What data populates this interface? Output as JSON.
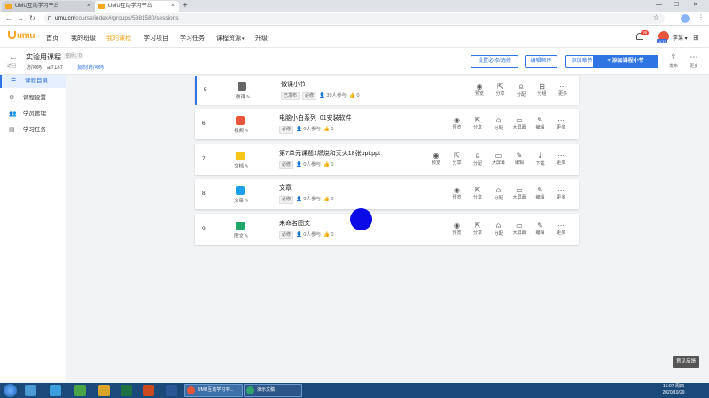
{
  "browser": {
    "tabs": [
      {
        "label": "UMU互动学习平台"
      },
      {
        "label": "UMU互动学习平台"
      }
    ],
    "url_host": "umu.cn",
    "url_path": "/course/index#/groups/5381580/sessions"
  },
  "topnav": {
    "logo": "umu",
    "items": [
      "首页",
      "我的班级",
      "我的课程",
      "学习项目",
      "学习任务",
      "课程资源",
      "升级"
    ],
    "active": "我的课程",
    "notification_count": "99",
    "avatar_level": "LV.15",
    "username": "李某"
  },
  "course": {
    "back_label": "返回",
    "title": "实验用课程",
    "tag": "空间：0",
    "access_code_label": "访问码：",
    "access_code": "ai7187",
    "copy_link": "复制访问码",
    "buttons": {
      "required": "设置必修/选修",
      "order": "编辑顺序",
      "chapter": "添加章节",
      "add_section": "添加课程小节"
    },
    "tools": {
      "publish": "发布",
      "more": "更多"
    }
  },
  "sidebar": {
    "items": [
      {
        "label": "课程目录",
        "icon": "list-icon"
      },
      {
        "label": "课程设置",
        "icon": "gear-icon"
      },
      {
        "label": "学员管理",
        "icon": "users-icon"
      },
      {
        "label": "学习任务",
        "icon": "clipboard-icon"
      }
    ]
  },
  "sessions": [
    {
      "num": "5",
      "type": "微课",
      "title": "微课小节",
      "status": "已发布",
      "req": "必修",
      "participants": "39人参与",
      "likes": "0",
      "color": "#666666",
      "actions": [
        "预览",
        "分享",
        "分配",
        "分组",
        "更多"
      ]
    },
    {
      "num": "6",
      "type": "视频",
      "title": "电脑小白系列_01安装软件",
      "req": "必修",
      "participants": "0人参与",
      "likes": "0",
      "color": "#e8553b",
      "actions": [
        "预览",
        "分享",
        "分配",
        "大屏幕",
        "编辑",
        "更多"
      ]
    },
    {
      "num": "7",
      "type": "文档",
      "title": "第7单元课题1燃烧和灭火18张ppt.ppt",
      "req": "必修",
      "participants": "0人参与",
      "likes": "0",
      "color": "#f5c518",
      "actions": [
        "预览",
        "分享",
        "分配",
        "大屏幕",
        "编辑",
        "下载",
        "更多"
      ]
    },
    {
      "num": "8",
      "type": "文章",
      "title": "文章",
      "req": "必修",
      "participants": "0人参与",
      "likes": "0",
      "color": "#1aa0e8",
      "actions": [
        "预览",
        "分享",
        "分配",
        "大屏幕",
        "编辑",
        "更多"
      ]
    },
    {
      "num": "9",
      "type": "图文",
      "title": "未命名图文",
      "req": "必修",
      "participants": "0人参与",
      "likes": "0",
      "color": "#1fa86a",
      "actions": [
        "预览",
        "分享",
        "分配",
        "大屏幕",
        "编辑",
        "更多"
      ]
    }
  ],
  "feedback": "意见反馈",
  "taskbar": {
    "windows": [
      "UMU互动学习平...",
      "演示文稿"
    ],
    "time": "15:07 周四",
    "date": "2020/10/29"
  }
}
